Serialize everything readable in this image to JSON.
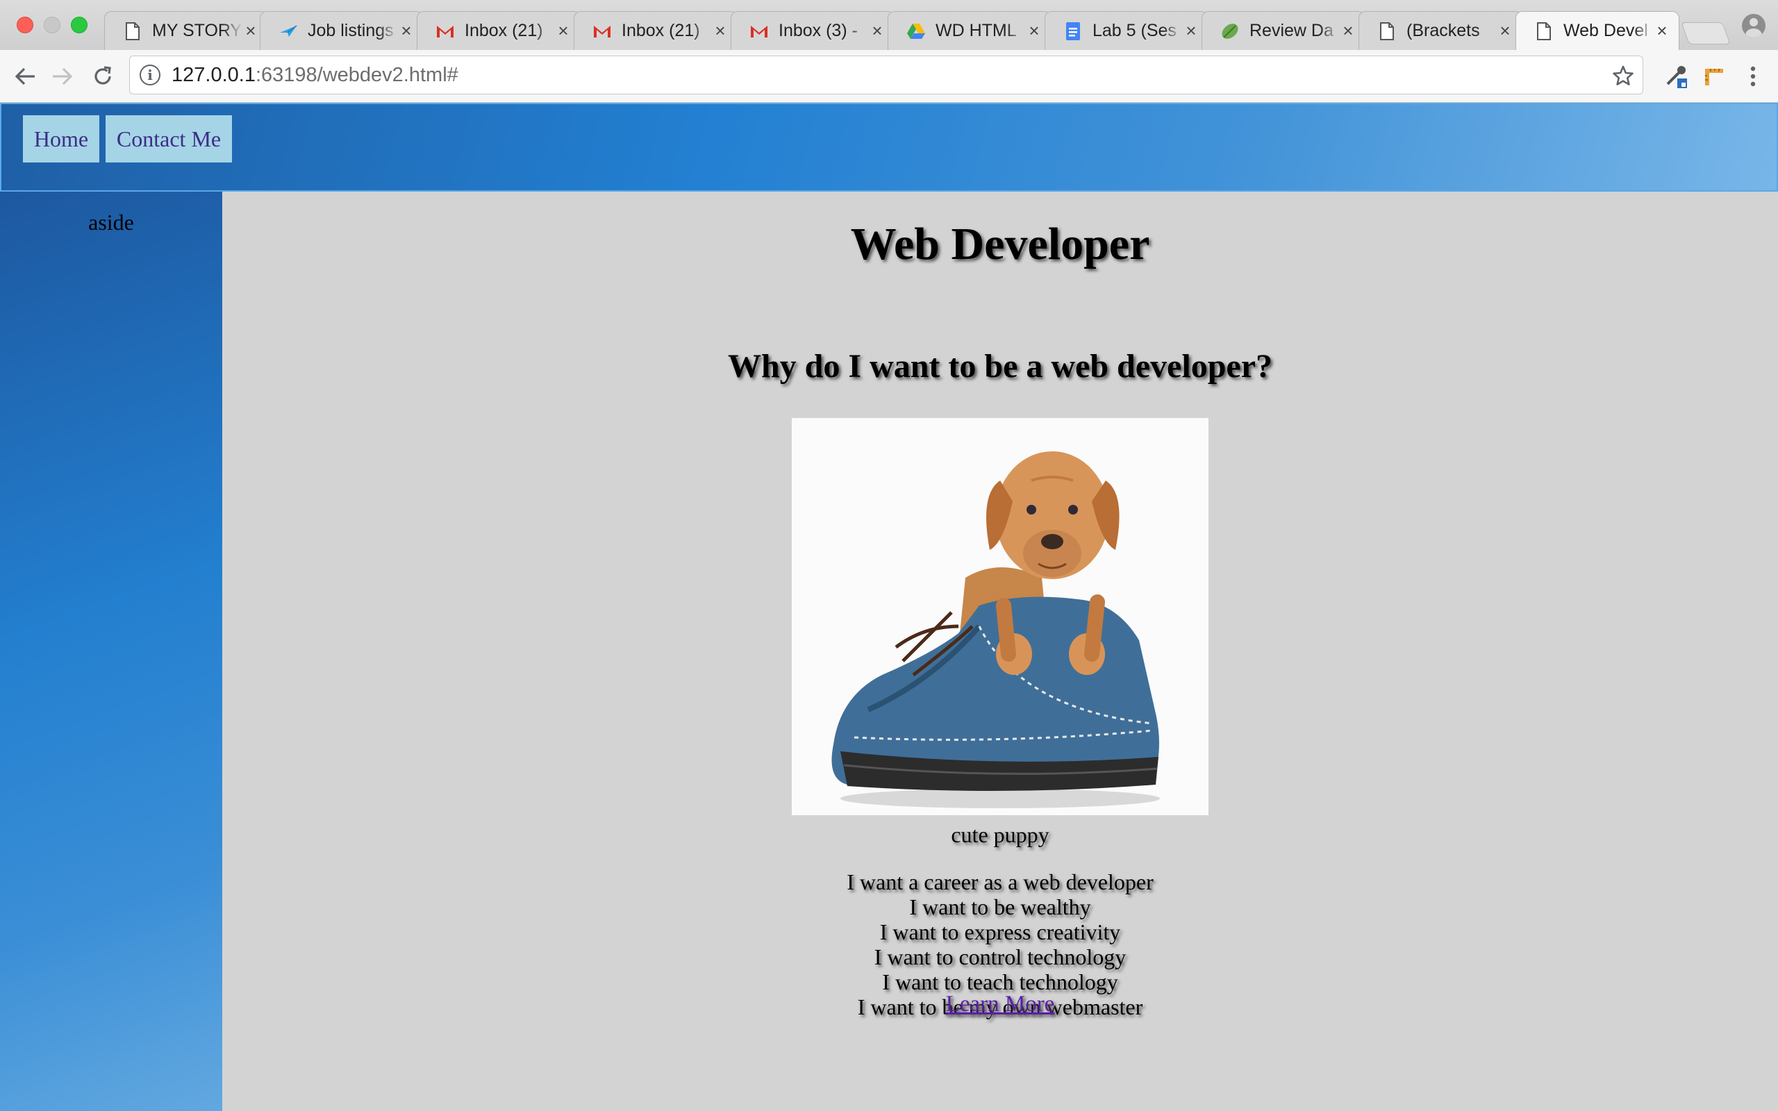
{
  "browser": {
    "tabs": [
      {
        "label": "MY STORY",
        "icon": "document-icon"
      },
      {
        "label": "Job listings",
        "icon": "plane-icon"
      },
      {
        "label": "Inbox (21)",
        "icon": "gmail-icon"
      },
      {
        "label": "Inbox (21)",
        "icon": "gmail-icon"
      },
      {
        "label": "Inbox (3) -",
        "icon": "gmail-icon"
      },
      {
        "label": "WD HTML",
        "icon": "drive-icon"
      },
      {
        "label": "Lab 5 (Ses",
        "icon": "docs-icon"
      },
      {
        "label": "Review Da",
        "icon": "leaf-icon"
      },
      {
        "label": "(Brackets",
        "icon": "document-icon"
      },
      {
        "label": "Web Devel",
        "icon": "document-icon"
      }
    ],
    "active_tab_index": 9,
    "url_host": "127.0.0.1",
    "url_rest": ":63198/webdev2.html#"
  },
  "nav": {
    "home_label": "Home",
    "contact_label": "Contact Me"
  },
  "aside": {
    "label": "aside"
  },
  "main": {
    "title": "Web Developer",
    "subtitle": "Why do I want to be a web developer?",
    "image_caption": "cute puppy",
    "reasons": [
      "I want a career as a web developer",
      "I want to be wealthy",
      "I want to express creativity",
      "I want to control technology",
      "I want to teach technology",
      "I want to be my own webmaster"
    ],
    "learn_more_label": "Learn More"
  },
  "colors": {
    "header_gradient_start": "#1f5fa6",
    "header_gradient_end": "#78b6e8",
    "nav_button_bg": "#a5d4e6",
    "nav_text": "#3c2e86",
    "page_bg": "#d3d3d3",
    "link": "#5a1fa6"
  }
}
